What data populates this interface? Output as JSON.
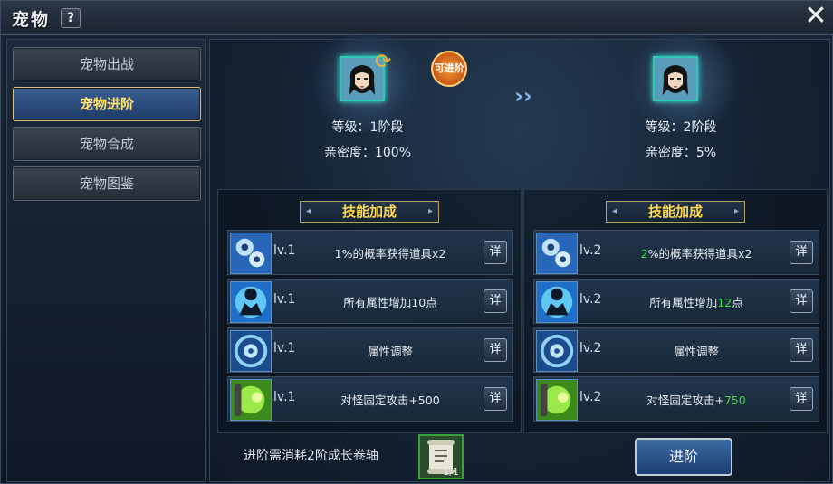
{
  "window": {
    "title": "宠物",
    "help_label": "?",
    "close_label": "✕"
  },
  "nav": {
    "items": [
      {
        "label": "宠物出战",
        "active": false
      },
      {
        "label": "宠物进阶",
        "active": true
      },
      {
        "label": "宠物合成",
        "active": false
      },
      {
        "label": "宠物图鉴",
        "active": false
      }
    ]
  },
  "current_pet": {
    "stage": "等级：1阶段",
    "affinity": "亲密度：100%",
    "badge": "可进阶"
  },
  "next_pet": {
    "stage": "等级：2阶段",
    "affinity": "亲密度：5%"
  },
  "arrow": "››",
  "left_skills": {
    "header": "技能加成",
    "rows": [
      {
        "icon": "crystal-skill-icon",
        "level": "lv.1",
        "desc_a": "1%的概率获得道具x2",
        "desc_hl": "",
        "desc_b": "",
        "detail": "详"
      },
      {
        "icon": "figure-skill-icon",
        "level": "lv.1",
        "desc_a": "所有属性增加10点",
        "desc_hl": "",
        "desc_b": "",
        "detail": "详"
      },
      {
        "icon": "rune-wheel-icon",
        "level": "lv.1",
        "desc_a": "属性调整",
        "desc_hl": "",
        "desc_b": "",
        "detail": "详"
      },
      {
        "icon": "chain-skill-icon",
        "level": "lv.1",
        "desc_a": "对怪固定攻击+500",
        "desc_hl": "",
        "desc_b": "",
        "detail": "详"
      }
    ]
  },
  "right_skills": {
    "header": "技能加成",
    "rows": [
      {
        "icon": "crystal-skill-icon",
        "level": "lv.2",
        "desc_a": "",
        "desc_hl": "2",
        "desc_b": "%的概率获得道具x2",
        "detail": "详"
      },
      {
        "icon": "figure-skill-icon",
        "level": "lv.2",
        "desc_a": "所有属性增加",
        "desc_hl": "12",
        "desc_b": "点",
        "detail": "详"
      },
      {
        "icon": "rune-wheel-icon",
        "level": "lv.2",
        "desc_a": "属性调整",
        "desc_hl": "",
        "desc_b": "",
        "detail": "详"
      },
      {
        "icon": "chain-skill-icon",
        "level": "lv.2",
        "desc_a": "对怪固定攻击+",
        "desc_hl": "750",
        "desc_b": "",
        "detail": "详"
      }
    ]
  },
  "bottom": {
    "cost_label": "进阶需消耗2阶成长卷轴",
    "scroll_count": "1/1",
    "advance_label": "进阶"
  },
  "colors": {
    "highlight": "#35e03a",
    "active_text": "#ffe36a",
    "header_text": "#ffd84a"
  }
}
